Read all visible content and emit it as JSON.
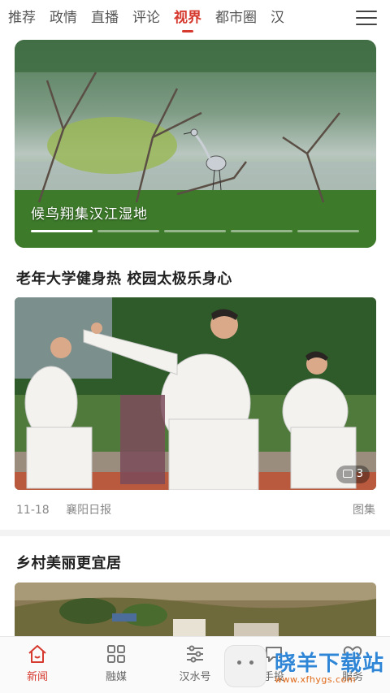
{
  "tabs": [
    {
      "label": "推荐"
    },
    {
      "label": "政情"
    },
    {
      "label": "直播"
    },
    {
      "label": "评论"
    },
    {
      "label": "视界",
      "active": true
    },
    {
      "label": "都市圈"
    },
    {
      "label": "汉"
    }
  ],
  "hero": {
    "caption": "候鸟翔集汉江湿地",
    "slides": 5,
    "current": 1
  },
  "article1": {
    "title": "老年大学健身热 校园太极乐身心",
    "date": "11-18",
    "source": "襄阳日报",
    "category": "图集",
    "photo_count": "3"
  },
  "article2": {
    "title": "乡村美丽更宜居"
  },
  "bottom_nav": [
    {
      "label": "新闻",
      "icon": "home-icon",
      "active": true
    },
    {
      "label": "融媒",
      "icon": "grid-icon"
    },
    {
      "label": "汉水号",
      "icon": "sliders-icon"
    },
    {
      "label": "手投",
      "icon": "chat-icon"
    },
    {
      "label": "服务",
      "icon": "heart-icon"
    }
  ],
  "watermark": {
    "title": "晓羊下载站",
    "url": "www.xfhygs.com"
  },
  "colors": {
    "accent": "#d63a2f",
    "watermark_blue": "#2f86d6",
    "watermark_orange": "#e06a1a"
  }
}
